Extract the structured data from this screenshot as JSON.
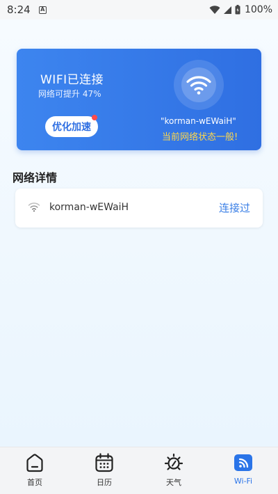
{
  "status_bar": {
    "time": "8:24",
    "notification_icon": "a-icon",
    "battery": "100%"
  },
  "wifi_card": {
    "status_title": "WIFI已连接",
    "boost_text": "网络可提升 47%",
    "optimize_button": "优化加速",
    "ssid_quoted": "\"korman-wEWaiH\"",
    "network_state": "当前网络状态一般!",
    "icon": "wifi-icon"
  },
  "details": {
    "section_title": "网络详情",
    "network": {
      "ssid": "korman-wEWaiH",
      "status": "连接过",
      "icon": "wifi-signal-icon"
    }
  },
  "bottom_nav": {
    "items": [
      {
        "label": "首页",
        "icon": "home-icon"
      },
      {
        "label": "日历",
        "icon": "calendar-icon"
      },
      {
        "label": "天气",
        "icon": "weather-icon"
      },
      {
        "label": "Wi-Fi",
        "icon": "wifi-tab-icon"
      }
    ],
    "active_index": 3
  },
  "colors": {
    "accent": "#2f6fe2",
    "warning_text": "#ffd84a",
    "badge_dot": "#ff4a4a"
  }
}
